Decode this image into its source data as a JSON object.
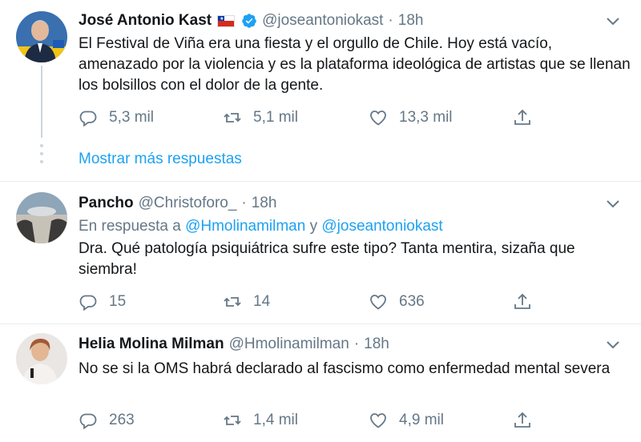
{
  "tweets": [
    {
      "name": "José Antonio Kast",
      "handle": "@joseantoniokast",
      "time": "18h",
      "text": "El Festival de Viña era una fiesta y el orgullo de Chile. Hoy está vacío, amenazado por la violencia y es la plataforma ideológica de artistas que se llenan los bolsillos con el dolor de la gente.",
      "replies": "5,3 mil",
      "retweets": "5,1 mil",
      "likes": "13,3 mil"
    },
    {
      "name": "Pancho",
      "handle": "@Christoforo_",
      "time": "18h",
      "reply_prefix": "En respuesta a",
      "reply_user1": "@Hmolinamilman",
      "reply_and": "y",
      "reply_user2": "@joseantoniokast",
      "text": "Dra. Qué patología psiquiátrica sufre este tipo? Tanta mentira, sizaña que siembra!",
      "replies": "15",
      "retweets": "14",
      "likes": "636"
    },
    {
      "name": "Helia Molina Milman",
      "handle": "@Hmolinamilman",
      "time": "18h",
      "text": "No se si la OMS habrá declarado al fascismo como enfermedad mental severa",
      "replies": "263",
      "retweets": "1,4 mil",
      "likes": "4,9 mil"
    }
  ],
  "show_more": "Mostrar más respuestas",
  "separator_dot": "·",
  "colors": {
    "accent": "#1da1f2",
    "muted": "#657786",
    "text": "#14171a",
    "line": "#ccd6dd"
  }
}
